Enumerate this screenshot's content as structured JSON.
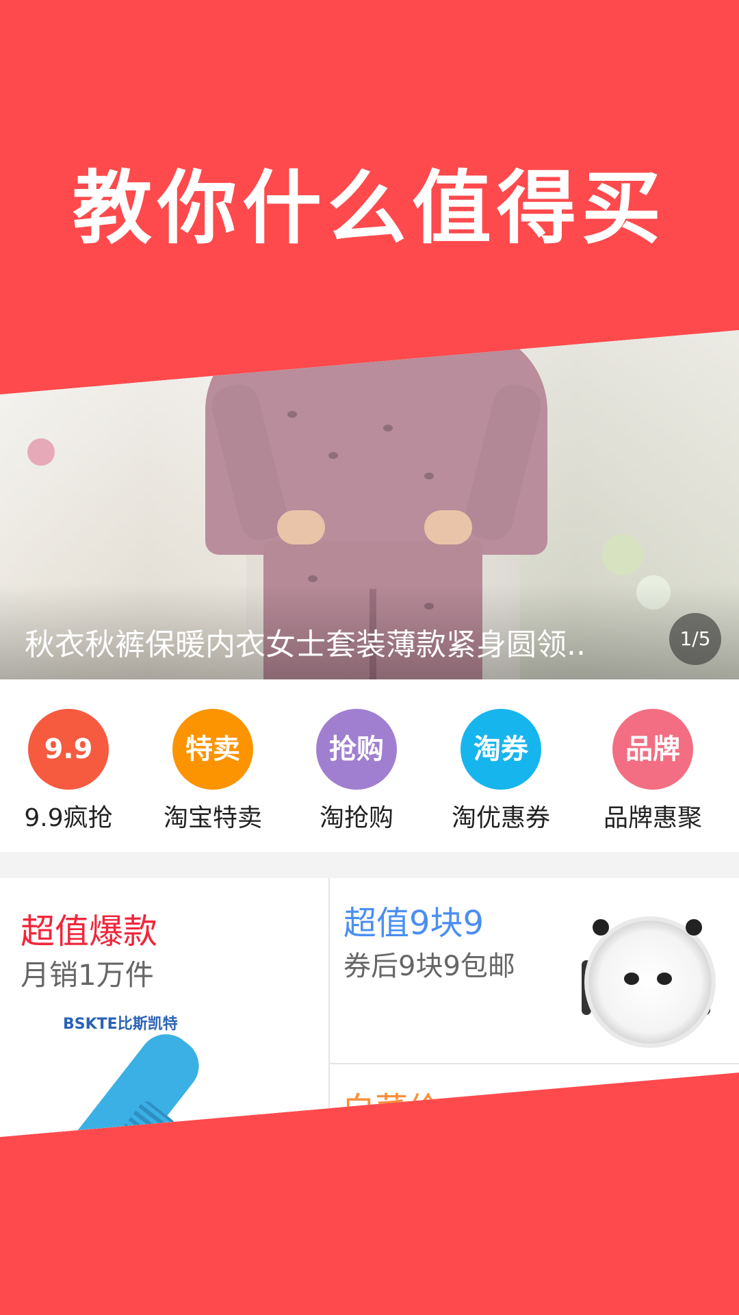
{
  "headline": "教你什么值得买",
  "banner": {
    "caption": "秋衣秋裤保暖内衣女士套装薄款紧身圆领..",
    "page_indicator": "1/5"
  },
  "categories": [
    {
      "icon_text": "9.9",
      "label": "9.9疯抢",
      "color": "#f65a3f"
    },
    {
      "icon_text": "特卖",
      "label": "淘宝特卖",
      "color": "#fb9400"
    },
    {
      "icon_text": "抢购",
      "label": "淘抢购",
      "color": "#a07fd0"
    },
    {
      "icon_text": "淘券",
      "label": "淘优惠券",
      "color": "#17b5ee"
    },
    {
      "icon_text": "品牌",
      "label": "品牌惠聚",
      "color": "#f36e82"
    }
  ],
  "promos": {
    "left": {
      "title": "超值爆款",
      "subtitle": "月销1万件",
      "brand": "BSKTE比斯凯特"
    },
    "right_top": {
      "title": "超值9块9",
      "subtitle": "券后9块9包邮"
    },
    "right_bottom": {
      "title": "白菜价"
    }
  },
  "colors": {
    "primary_red": "#fe4a4d"
  }
}
